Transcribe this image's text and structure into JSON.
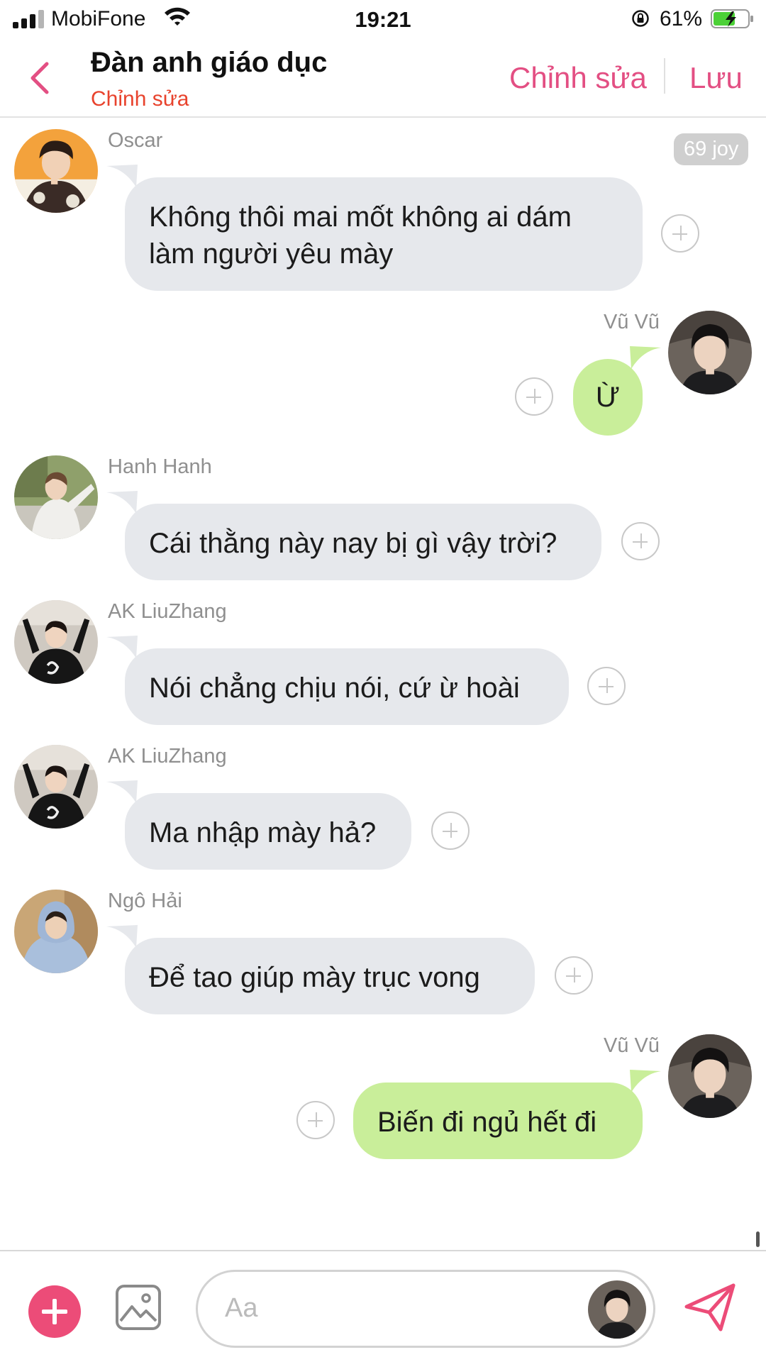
{
  "status_bar": {
    "carrier": "MobiFone",
    "time": "19:21",
    "battery": "61%"
  },
  "header": {
    "title": "Đàn anh giáo dục",
    "subtitle": "Chỉnh sửa",
    "edit_label": "Chỉnh sửa",
    "save_label": "Lưu"
  },
  "messages": [
    {
      "sender": "Oscar",
      "side": "left",
      "lines": [
        "Không thôi mai mốt không ai dám",
        "làm người yêu mày"
      ]
    },
    {
      "sender": "Vũ Vũ",
      "side": "right",
      "lines": [
        "Ừ"
      ]
    },
    {
      "sender": "Hanh Hanh",
      "side": "left",
      "lines": [
        "Cái thằng này nay bị gì vậy trời?"
      ]
    },
    {
      "sender": "AK LiuZhang",
      "side": "left",
      "lines": [
        "Nói chẳng chịu nói, cứ ừ hoài"
      ]
    },
    {
      "sender": "AK LiuZhang",
      "side": "left",
      "lines": [
        "Ma nhập mày hả?"
      ]
    },
    {
      "sender": "Ngô Hải",
      "side": "left",
      "lines": [
        "Để tao giúp mày trục vong"
      ]
    },
    {
      "sender": "Vũ Vũ",
      "side": "right",
      "lines": [
        "Biến đi ngủ hết đi"
      ]
    }
  ],
  "badge": {
    "label": "69 joy"
  },
  "composer": {
    "placeholder": "Aa"
  },
  "colors": {
    "accent": "#e34f83",
    "subtitle": "#e8432d",
    "left_bubble": "#e6e8ec",
    "right_bubble": "#c9ee9a"
  }
}
